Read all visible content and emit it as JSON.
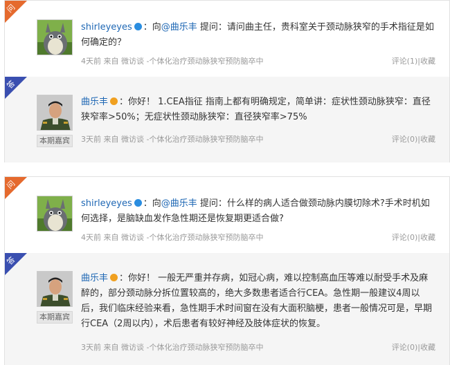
{
  "threads": [
    {
      "question": {
        "tag": "问",
        "user": "shirleyeyes",
        "prefix": "：向",
        "mention": "@曲乐丰",
        "body": " 提问：请问曲主任，贵科室关于颈动脉狭窄的手术指征是如何确定的？",
        "time": "4天前",
        "from": " 来自 ",
        "source": "微访谈 -个体化治疗颈动脉狭窄预防脑卒中",
        "comment": "评论(1)",
        "sep": "|",
        "fav": "收藏"
      },
      "answer": {
        "tag": "答",
        "user": "曲乐丰",
        "badge": "本期嘉宾",
        "body": "：你好！ 1.CEA指征 指南上都有明确规定，简单讲：症状性颈动脉狭窄：直径狭窄率>50%；无症状性颈动脉狭窄：直径狭窄率>75%",
        "time": "3天前",
        "from": " 来自 ",
        "source": "微访谈 -个体化治疗颈动脉狭窄预防脑卒中",
        "comment": "评论(0)",
        "sep": "|",
        "fav": "收藏"
      }
    },
    {
      "question": {
        "tag": "问",
        "user": "shirleyeyes",
        "prefix": "：向",
        "mention": "@曲乐丰",
        "body": " 提问：什么样的病人适合做颈动脉内膜切除术?手术时机如何选择，是脑缺血发作急性期还是恢复期更适合做?",
        "time": "4天前",
        "from": " 来自 ",
        "source": "微访谈 -个体化治疗颈动脉狭窄预防脑卒中",
        "comment": "评论(0)",
        "sep": "|",
        "fav": "收藏"
      },
      "answer": {
        "tag": "答",
        "user": "曲乐丰",
        "badge": "本期嘉宾",
        "body": "：你好！ 一般无严重并存病，如冠心病，难以控制高血压等难以耐受手术及麻醉的，部分颈动脉分拆位置较高的，绝大多数患者适合行CEA。急性期一般建议4周以后，我们临床经验来看，急性期手术时间窗在没有大面积脑梗，患者一般情况可是，早期行CEA（2周以内），术后患者有较好神经及肢体症状的恢复。",
        "time": "3天前",
        "from": " 来自 ",
        "source": "微访谈 -个体化治疗颈动脉狭窄预防脑卒中",
        "comment": "评论(0)",
        "sep": "|",
        "fav": "收藏"
      }
    }
  ],
  "colors": {
    "question_tag": "#e56a2e",
    "answer_tag": "#3a4fb0",
    "link": "#1e67b4",
    "vip_q": "#2a8de0",
    "vip_a": "#f0a020"
  },
  "icons": {
    "question_avatar": "totoro-avatar",
    "answer_avatar": "doctor-avatar",
    "question_vip": "blue-verified-icon",
    "answer_vip": "gold-verified-icon"
  }
}
